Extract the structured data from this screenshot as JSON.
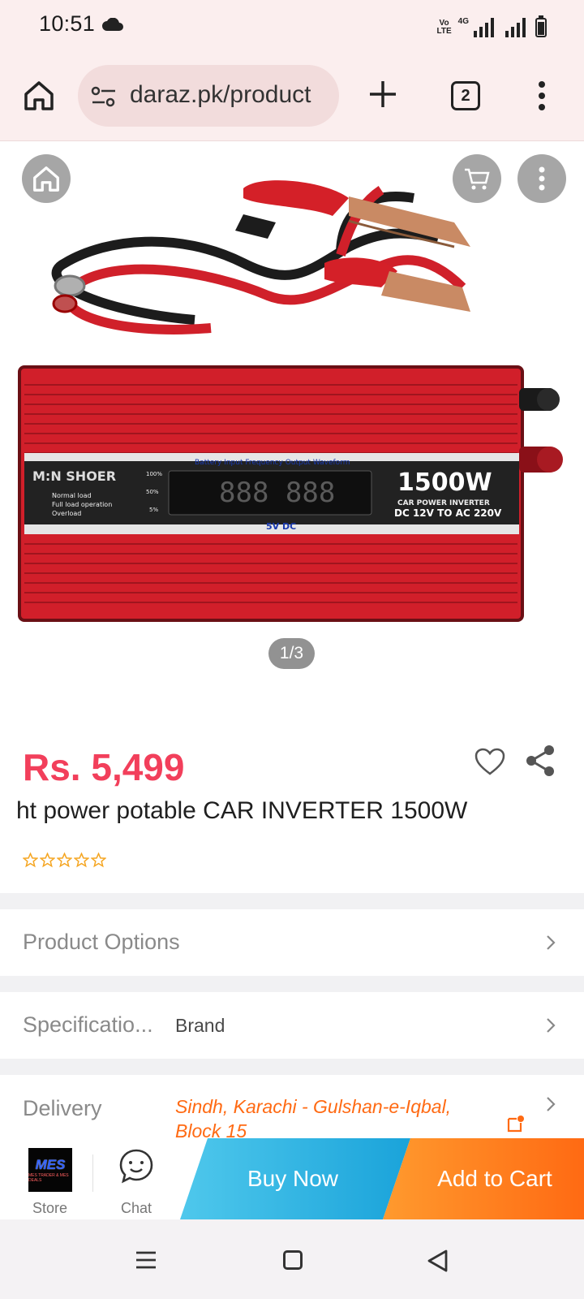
{
  "status_bar": {
    "time": "10:51",
    "icons": [
      "cloud-icon",
      "volte-icon",
      "signal-4g-icon",
      "signal-icon",
      "battery-icon"
    ],
    "network_tag": "4G",
    "volte_text": "Vo LTE"
  },
  "browser": {
    "url": "daraz.pk/product",
    "tab_count": "2",
    "icons": [
      "home-icon",
      "tune-icon",
      "plus-icon",
      "tabs-icon",
      "more-vert-icon"
    ]
  },
  "gallery": {
    "counter": "1/3",
    "image_text": {
      "brand": "M:N SHOER",
      "rating": "1500W",
      "line1": "CAR POWER INVERTER",
      "line2": "DC 12V TO AC 220V",
      "usb": "5V DC",
      "panel_labels": "Battery  Input  Frequency  Output  Waveform",
      "legend": [
        "Normal load",
        "Full load operation",
        "Overload"
      ],
      "levels": [
        "100%",
        "50%",
        "5%"
      ]
    }
  },
  "product": {
    "price": "Rs. 5,499",
    "title": "ht power potable CAR INVERTER 1500W",
    "stars_filled": 0,
    "stars_total": 5
  },
  "rows": {
    "options_label": "Product Options",
    "spec_label": "Specificatio...",
    "spec_value": "Brand",
    "delivery_label": "Delivery",
    "delivery_value": "Sindh, Karachi - Gulshan-e-Iqbal, Block 15"
  },
  "action_bar": {
    "store_label": "Store",
    "store_logo_text": "MES",
    "store_logo_sub": "MES TRADER & MES DEALS",
    "chat_label": "Chat",
    "buy_now": "Buy Now",
    "add_to_cart": "Add to Cart"
  },
  "colors": {
    "price": "#f23f5b",
    "buy_now": "#1aa3da",
    "add_to_cart": "#ff6a13",
    "delivery_text": "#ff6a13",
    "browser_bg": "#fbeeee"
  }
}
